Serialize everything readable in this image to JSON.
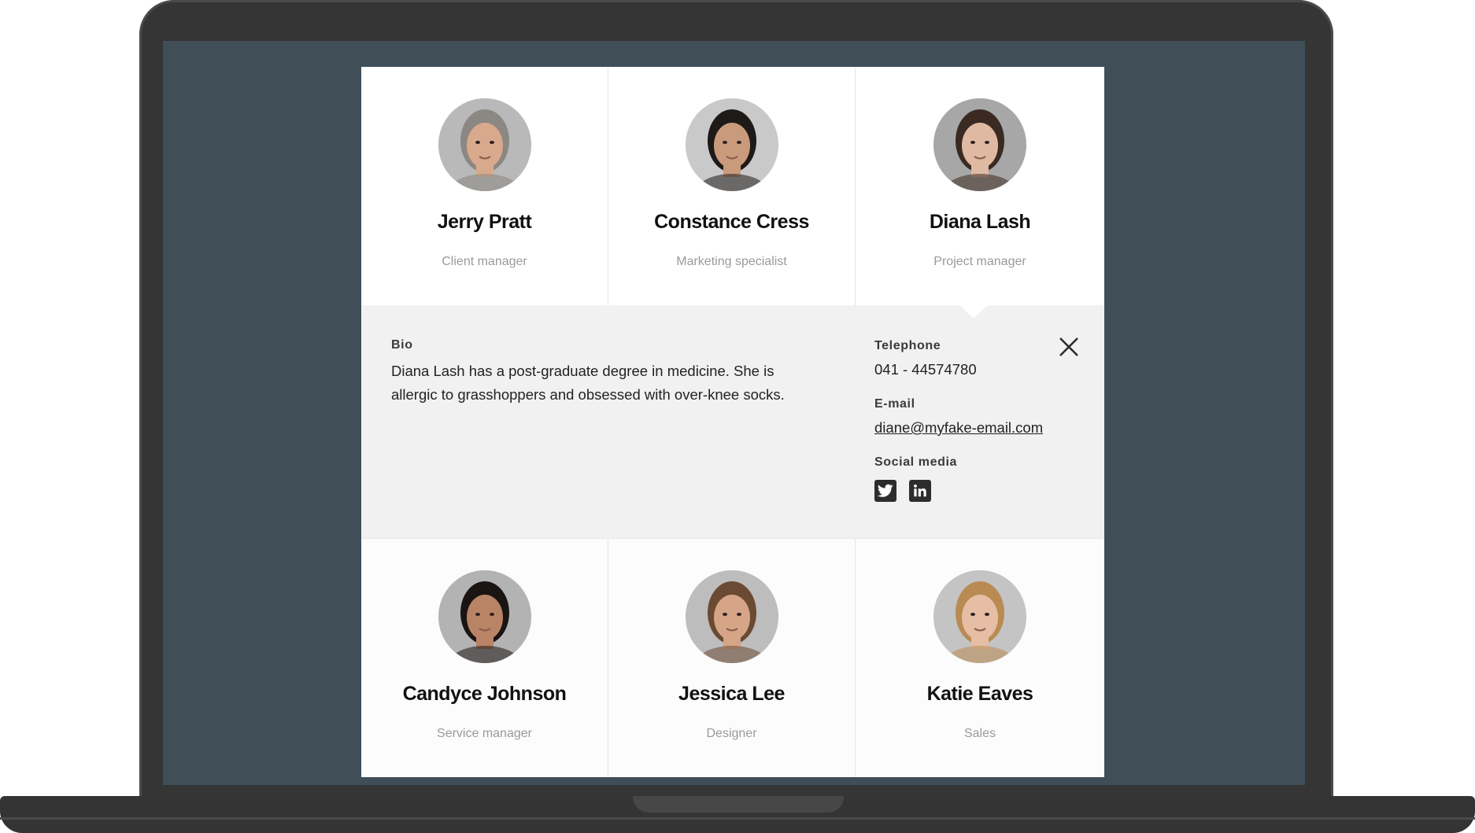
{
  "team": {
    "top_row": [
      {
        "name": "Jerry Pratt",
        "role": "Client manager",
        "avatar": {
          "bg": "#b9b9b9",
          "skin": "#d9a98d",
          "hair": "#8b8782"
        }
      },
      {
        "name": "Constance Cress",
        "role": "Marketing specialist",
        "avatar": {
          "bg": "#c9c9c9",
          "skin": "#c99a7c",
          "hair": "#1e1a17"
        }
      },
      {
        "name": "Diana Lash",
        "role": "Project manager",
        "avatar": {
          "bg": "#a7a7a7",
          "skin": "#e0b9a3",
          "hair": "#3a2a22"
        }
      }
    ],
    "bottom_row": [
      {
        "name": "Candyce Johnson",
        "role": "Service manager",
        "avatar": {
          "bg": "#b3b3b3",
          "skin": "#b98466",
          "hair": "#1a1412"
        }
      },
      {
        "name": "Jessica Lee",
        "role": "Designer",
        "avatar": {
          "bg": "#bdbdbd",
          "skin": "#d6a487",
          "hair": "#6a4a33"
        }
      },
      {
        "name": "Katie Eaves",
        "role": "Sales",
        "avatar": {
          "bg": "#c4c4c4",
          "skin": "#e6bda5",
          "hair": "#b98b52"
        }
      }
    ]
  },
  "detail": {
    "bio_label": "Bio",
    "bio_text": "Diana Lash has a post-graduate degree in medicine. She is allergic to grasshoppers and obsessed with over-knee socks.",
    "telephone_label": "Telephone",
    "telephone": "041 - 44574780",
    "email_label": "E-mail",
    "email": "diane@myfake-email.com",
    "social_label": "Social media",
    "socials": [
      {
        "name": "twitter-icon"
      },
      {
        "name": "linkedin-icon"
      }
    ],
    "close_icon": "close-icon"
  },
  "colors": {
    "screen_bg": "#3f4e57",
    "laptop_frame": "#353535",
    "detail_bg": "#f1f1f1",
    "name_text": "#111111",
    "role_text": "#9a9a9a"
  }
}
